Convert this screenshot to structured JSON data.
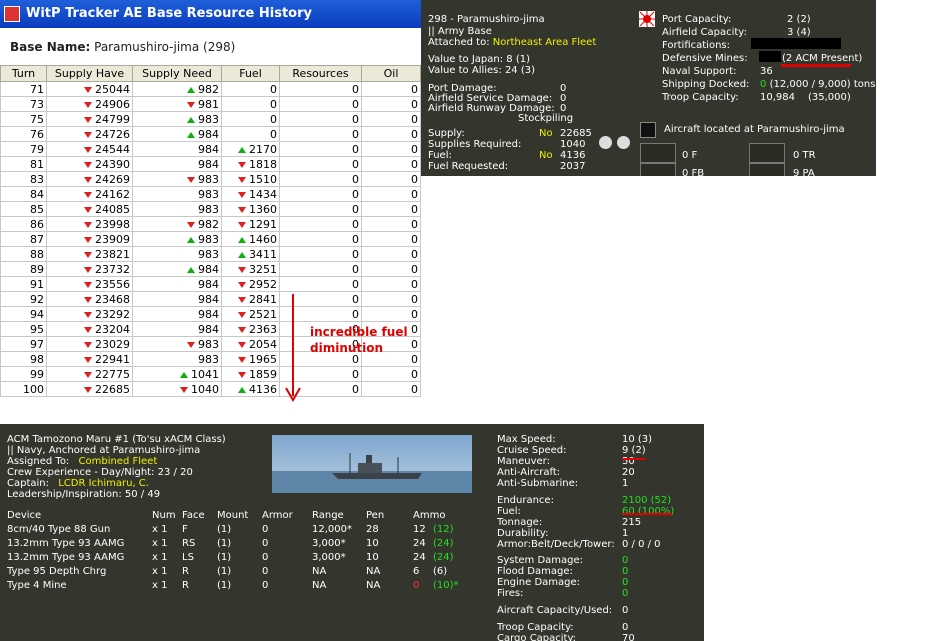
{
  "tracker": {
    "title": "WitP Tracker AE Base Resource History",
    "base_label": "Base Name:",
    "base_value": "Paramushiro-jima (298)",
    "columns": [
      "Turn",
      "Supply Have",
      "Supply Need",
      "Fuel",
      "Resources",
      "Oil"
    ],
    "rows": [
      {
        "turn": "71",
        "supply": "25044",
        "sd": "down",
        "need": "982",
        "nd": "up",
        "fuel": "0",
        "fd": "",
        "res": "0",
        "oil": "0"
      },
      {
        "turn": "73",
        "supply": "24906",
        "sd": "down",
        "need": "981",
        "nd": "down",
        "fuel": "0",
        "fd": "",
        "res": "0",
        "oil": "0"
      },
      {
        "turn": "75",
        "supply": "24799",
        "sd": "down",
        "need": "983",
        "nd": "up",
        "fuel": "0",
        "fd": "",
        "res": "0",
        "oil": "0"
      },
      {
        "turn": "76",
        "supply": "24726",
        "sd": "down",
        "need": "984",
        "nd": "up",
        "fuel": "0",
        "fd": "",
        "res": "0",
        "oil": "0"
      },
      {
        "turn": "79",
        "supply": "24544",
        "sd": "down",
        "need": "984",
        "nd": "",
        "fuel": "2170",
        "fd": "up",
        "res": "0",
        "oil": "0"
      },
      {
        "turn": "81",
        "supply": "24390",
        "sd": "down",
        "need": "984",
        "nd": "",
        "fuel": "1818",
        "fd": "down",
        "res": "0",
        "oil": "0"
      },
      {
        "turn": "83",
        "supply": "24269",
        "sd": "down",
        "need": "983",
        "nd": "down",
        "fuel": "1510",
        "fd": "down",
        "res": "0",
        "oil": "0"
      },
      {
        "turn": "84",
        "supply": "24162",
        "sd": "down",
        "need": "983",
        "nd": "",
        "fuel": "1434",
        "fd": "down",
        "res": "0",
        "oil": "0"
      },
      {
        "turn": "85",
        "supply": "24085",
        "sd": "down",
        "need": "983",
        "nd": "",
        "fuel": "1360",
        "fd": "down",
        "res": "0",
        "oil": "0"
      },
      {
        "turn": "86",
        "supply": "23998",
        "sd": "down",
        "need": "982",
        "nd": "down",
        "fuel": "1291",
        "fd": "down",
        "res": "0",
        "oil": "0"
      },
      {
        "turn": "87",
        "supply": "23909",
        "sd": "down",
        "need": "983",
        "nd": "up",
        "fuel": "1460",
        "fd": "up",
        "res": "0",
        "oil": "0"
      },
      {
        "turn": "88",
        "supply": "23821",
        "sd": "down",
        "need": "983",
        "nd": "",
        "fuel": "3411",
        "fd": "up",
        "res": "0",
        "oil": "0"
      },
      {
        "turn": "89",
        "supply": "23732",
        "sd": "down",
        "need": "984",
        "nd": "up",
        "fuel": "3251",
        "fd": "down",
        "res": "0",
        "oil": "0"
      },
      {
        "turn": "91",
        "supply": "23556",
        "sd": "down",
        "need": "984",
        "nd": "",
        "fuel": "2952",
        "fd": "down",
        "res": "0",
        "oil": "0"
      },
      {
        "turn": "92",
        "supply": "23468",
        "sd": "down",
        "need": "984",
        "nd": "",
        "fuel": "2841",
        "fd": "down",
        "res": "0",
        "oil": "0"
      },
      {
        "turn": "94",
        "supply": "23292",
        "sd": "down",
        "need": "984",
        "nd": "",
        "fuel": "2521",
        "fd": "down",
        "res": "0",
        "oil": "0"
      },
      {
        "turn": "95",
        "supply": "23204",
        "sd": "down",
        "need": "984",
        "nd": "",
        "fuel": "2363",
        "fd": "down",
        "res": "0",
        "oil": "0"
      },
      {
        "turn": "97",
        "supply": "23029",
        "sd": "down",
        "need": "983",
        "nd": "down",
        "fuel": "2054",
        "fd": "down",
        "res": "0",
        "oil": "0"
      },
      {
        "turn": "98",
        "supply": "22941",
        "sd": "down",
        "need": "983",
        "nd": "",
        "fuel": "1965",
        "fd": "down",
        "res": "0",
        "oil": "0"
      },
      {
        "turn": "99",
        "supply": "22775",
        "sd": "down",
        "need": "1041",
        "nd": "up",
        "fuel": "1859",
        "fd": "down",
        "res": "0",
        "oil": "0"
      },
      {
        "turn": "100",
        "supply": "22685",
        "sd": "down",
        "need": "1040",
        "nd": "down",
        "fuel": "4136",
        "fd": "up",
        "res": "0",
        "oil": "0"
      }
    ],
    "annotation_line1": "incredible fuel",
    "annotation_line2": "diminution"
  },
  "base_panel": {
    "name": "298 - Paramushiro-jima",
    "type": "|| Army Base",
    "attached_label": "Attached to:",
    "attached_value": "Northeast Area Fleet",
    "value_japan": "Value to Japan:  8 (1)",
    "value_allies": "Value to Allies:  24 (3)",
    "port_damage_label": "Port Damage:",
    "port_damage": "0",
    "af_service_label": "Airfield Service Damage:",
    "af_service": "0",
    "af_runway_label": "Airfield Runway Damage:",
    "af_runway": "0",
    "stockpiling": "Stockpiling",
    "supply_label": "Supply:",
    "supply_flag": "No",
    "supply_value": "22685",
    "supplies_req_label": "Supplies Required:",
    "supplies_req": "1040",
    "fuel_label": "Fuel:",
    "fuel_flag": "No",
    "fuel_value": "4136",
    "fuel_req_label": "Fuel Requested:",
    "fuel_req": "2037",
    "port_cap_label": "Port Capacity:",
    "port_cap": "2 (2)",
    "af_cap_label": "Airfield Capacity:",
    "af_cap": "3 (4)",
    "fortifications_label": "Fortifications:",
    "def_mines_label": "Defensive Mines:",
    "def_mines_value": "(2 ACM Present)",
    "naval_support_label": "Naval Support:",
    "naval_support": "36",
    "shipping_label": "Shipping Docked:",
    "shipping_zero": "0",
    "shipping_rest": "(12,000 / 9,000) tons",
    "troop_cap_label": "Troop Capacity:",
    "troop_cap": "10,984",
    "troop_cap2": "(35,000)",
    "aircraft_located": "Aircraft located at Paramushiro-jima",
    "ac1": "0 F",
    "ac2": "0 TR",
    "ac3": "0 FB",
    "ac4": "9 PA"
  },
  "ship_panel": {
    "name": "ACM Tamozono Maru #1 (To'su xACM Class)",
    "status": "|| Navy, Anchored at Paramushiro-jima",
    "assigned_label": "Assigned To:",
    "assigned_value": "Combined Fleet",
    "crew": "Crew Experience - Day/Night: 23 / 20",
    "captain_label": "Captain:",
    "captain_value": "LCDR Ichimaru, C.",
    "leadership": "Leadership/Inspiration: 50 / 49",
    "dev_headers": [
      "Device",
      "Num",
      "Face",
      "Mount",
      "Armor",
      "Range",
      "Pen",
      "Ammo"
    ],
    "devices": [
      {
        "device": "8cm/40 Type 88 Gun",
        "num": "x 1",
        "face": "F",
        "mount": "(1)",
        "armor": "0",
        "range": "12,000*",
        "pen": "28",
        "ammo": "12",
        "ammo2": "(12)"
      },
      {
        "device": "13.2mm Type 93 AAMG",
        "num": "x 1",
        "face": "RS",
        "mount": "(1)",
        "armor": "0",
        "range": "3,000*",
        "pen": "10",
        "ammo": "24",
        "ammo2": "(24)"
      },
      {
        "device": "13.2mm Type 93 AAMG",
        "num": "x 1",
        "face": "LS",
        "mount": "(1)",
        "armor": "0",
        "range": "3,000*",
        "pen": "10",
        "ammo": "24",
        "ammo2": "(24)"
      },
      {
        "device": "Type 95 Depth Chrg",
        "num": "x 1",
        "face": "R",
        "mount": "(1)",
        "armor": "0",
        "range": "NA",
        "pen": "NA",
        "ammo": "6",
        "ammo2": "(6)"
      },
      {
        "device": "Type 4 Mine",
        "num": "x 1",
        "face": "R",
        "mount": "(1)",
        "armor": "0",
        "range": "NA",
        "pen": "NA",
        "ammo": "0",
        "ammo2": "(10)*"
      }
    ],
    "stats": [
      {
        "label": "Max Speed:",
        "value": "10 (3)",
        "color": "white"
      },
      {
        "label": "Cruise Speed:",
        "value": "9 (2)",
        "color": "white"
      },
      {
        "label": "Maneuver:",
        "value": "50",
        "color": "white"
      },
      {
        "label": "Anti-Aircraft:",
        "value": "20",
        "color": "white"
      },
      {
        "label": "Anti-Submarine:",
        "value": "1",
        "color": "white"
      },
      {
        "label": "Endurance:",
        "value": "2100 (52)",
        "color": "green"
      },
      {
        "label": "Fuel:",
        "value": "60 (100%)",
        "color": "green"
      },
      {
        "label": "Tonnage:",
        "value": "215",
        "color": "white"
      },
      {
        "label": "Durability:",
        "value": "1",
        "color": "white"
      },
      {
        "label": "Armor:Belt/Deck/Tower:",
        "value": "0 / 0 / 0",
        "color": "white"
      },
      {
        "label": "System Damage:",
        "value": "0",
        "color": "green"
      },
      {
        "label": "Flood Damage:",
        "value": "0",
        "color": "green"
      },
      {
        "label": "Engine Damage:",
        "value": "0",
        "color": "green"
      },
      {
        "label": "Fires:",
        "value": "0",
        "color": "green"
      },
      {
        "label": "Aircraft Capacity/Used:",
        "value": "0",
        "color": "white"
      },
      {
        "label": "Troop Capacity:",
        "value": "0",
        "color": "white"
      },
      {
        "label": "Cargo Capacity:",
        "value": "70",
        "color": "white"
      }
    ]
  }
}
